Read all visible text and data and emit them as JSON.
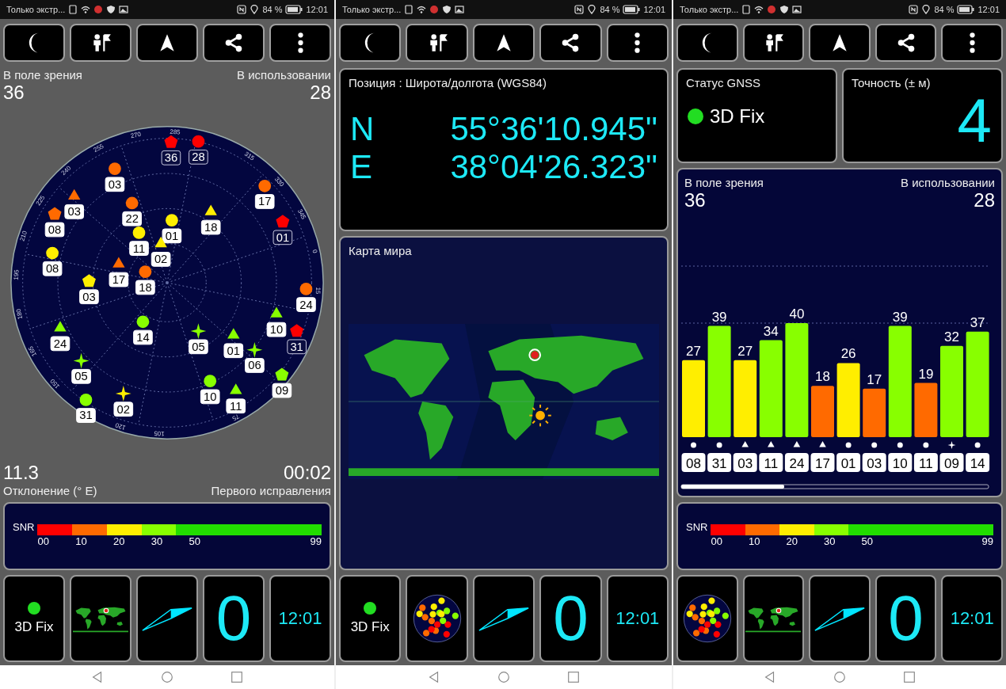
{
  "screens": [
    {
      "kind": "skyplot",
      "status_bar": {
        "notification": "Только экстр...",
        "battery": "84 %",
        "time": "12:01"
      },
      "in_view": {
        "label": "В поле зрения",
        "value": "36"
      },
      "in_use": {
        "label": "В использовании",
        "value": "28"
      },
      "sky_plot": {
        "azimuth_labels": [
          "0",
          "15",
          "75",
          "105",
          "120",
          "150",
          "165",
          "180",
          "195",
          "210",
          "225",
          "240",
          "255",
          "270",
          "285",
          "315",
          "330",
          "345"
        ],
        "satellites": [
          {
            "label": "36",
            "kind": "pentagon",
            "color": "#ff0000",
            "used": false
          },
          {
            "label": "28",
            "kind": "circle",
            "color": "#ff0000",
            "used": false
          },
          {
            "label": "03",
            "kind": "circle",
            "color": "#ff6a00",
            "used": true
          },
          {
            "label": "03",
            "kind": "triangle",
            "color": "#ff6a00",
            "used": true
          },
          {
            "label": "08",
            "kind": "pentagon",
            "color": "#ff6a00",
            "used": true
          },
          {
            "label": "22",
            "kind": "circle",
            "color": "#ff6a00",
            "used": true
          },
          {
            "label": "01",
            "kind": "circle",
            "color": "#ffee00",
            "used": true
          },
          {
            "label": "18",
            "kind": "triangle",
            "color": "#ffee00",
            "used": true
          },
          {
            "label": "17",
            "kind": "circle",
            "color": "#ff6a00",
            "used": true
          },
          {
            "label": "01",
            "kind": "pentagon",
            "color": "#ff0000",
            "used": false
          },
          {
            "label": "08",
            "kind": "circle",
            "color": "#ffee00",
            "used": true
          },
          {
            "label": "11",
            "kind": "circle",
            "color": "#ffee00",
            "used": true
          },
          {
            "label": "02",
            "kind": "triangle",
            "color": "#ffee00",
            "used": true
          },
          {
            "label": "17",
            "kind": "triangle",
            "color": "#ff6a00",
            "used": true
          },
          {
            "label": "18",
            "kind": "circle",
            "color": "#ff6a00",
            "used": true
          },
          {
            "label": "03",
            "kind": "pentagon",
            "color": "#ffee00",
            "used": true
          },
          {
            "label": "24",
            "kind": "circle",
            "color": "#ff6a00",
            "used": true
          },
          {
            "label": "10",
            "kind": "triangle",
            "color": "#88ff00",
            "used": true
          },
          {
            "label": "31",
            "kind": "pentagon",
            "color": "#ff0000",
            "used": false
          },
          {
            "label": "24",
            "kind": "triangle",
            "color": "#88ff00",
            "used": true
          },
          {
            "label": "14",
            "kind": "circle",
            "color": "#88ff00",
            "used": true
          },
          {
            "label": "05",
            "kind": "star",
            "color": "#88ff00",
            "used": true
          },
          {
            "label": "01",
            "kind": "triangle",
            "color": "#88ff00",
            "used": true
          },
          {
            "label": "06",
            "kind": "star",
            "color": "#88ff00",
            "used": true
          },
          {
            "label": "05",
            "kind": "star",
            "color": "#88ff00",
            "used": true
          },
          {
            "label": "09",
            "kind": "pentagon",
            "color": "#88ff00",
            "used": true
          },
          {
            "label": "10",
            "kind": "circle",
            "color": "#88ff00",
            "used": true
          },
          {
            "label": "31",
            "kind": "circle",
            "color": "#88ff00",
            "used": true
          },
          {
            "label": "02",
            "kind": "star",
            "color": "#ffee00",
            "used": true
          },
          {
            "label": "11",
            "kind": "triangle",
            "color": "#88ff00",
            "used": true
          }
        ]
      },
      "declination": {
        "label": "Отклонение (° E)",
        "value": "11.3"
      },
      "first_fix": {
        "label": "Первого исправления",
        "value": "00:02"
      },
      "snr_legend": {
        "title": "SNR",
        "end_label": "99",
        "segments": [
          {
            "label": "00",
            "color": "#ff0000"
          },
          {
            "label": "10",
            "color": "#ff6a00"
          },
          {
            "label": "20",
            "color": "#ffee00"
          },
          {
            "label": "30",
            "color": "#88ff00"
          },
          {
            "label": "50",
            "color": "#22dd00"
          }
        ]
      },
      "tiles": [
        {
          "kind": "fix",
          "text": "3D Fix"
        },
        {
          "kind": "map"
        },
        {
          "kind": "arrow"
        },
        {
          "kind": "number",
          "text": "0"
        },
        {
          "kind": "time",
          "text": "12:01"
        }
      ]
    },
    {
      "kind": "position",
      "status_bar": {
        "notification": "Только экстр...",
        "battery": "84 %",
        "time": "12:01"
      },
      "position": {
        "title": "Позиция : Широта/долгота (WGS84)",
        "rows": [
          {
            "hemisphere": "N",
            "value": "55°36'10.945\""
          },
          {
            "hemisphere": "E",
            "value": "38°04'26.323\""
          }
        ]
      },
      "world_map": {
        "title": "Карта мира"
      },
      "tiles": [
        {
          "kind": "fix",
          "text": "3D Fix"
        },
        {
          "kind": "sky"
        },
        {
          "kind": "arrow"
        },
        {
          "kind": "number",
          "text": "0"
        },
        {
          "kind": "time",
          "text": "12:01"
        }
      ]
    },
    {
      "kind": "signal",
      "status_bar": {
        "notification": "Только экстр...",
        "battery": "84 %",
        "time": "12:01"
      },
      "gnss_status": {
        "title": "Статус GNSS",
        "value": "3D Fix"
      },
      "accuracy": {
        "title": "Точность (± м)",
        "value": "4"
      },
      "signal_chart": {
        "in_view": {
          "label": "В поле зрения",
          "value": "36"
        },
        "in_use": {
          "label": "В использовании",
          "value": "28"
        },
        "bar_markers": [
          {
            "kind": "circle"
          },
          {
            "kind": "circle"
          },
          {
            "kind": "triangle"
          },
          {
            "kind": "triangle"
          },
          {
            "kind": "triangle"
          },
          {
            "kind": "triangle"
          },
          {
            "kind": "circle"
          },
          {
            "kind": "circle"
          },
          {
            "kind": "circle"
          },
          {
            "kind": "circle"
          },
          {
            "kind": "star"
          },
          {
            "kind": "circle"
          }
        ],
        "chart_data": {
          "type": "bar",
          "categories": [
            "08",
            "31",
            "03",
            "11",
            "24",
            "17",
            "01",
            "03",
            "10",
            "11",
            "09",
            "14"
          ],
          "values": [
            27,
            39,
            27,
            34,
            40,
            18,
            26,
            17,
            39,
            19,
            32,
            37
          ],
          "data_labels": true
        }
      },
      "snr_legend": {
        "title": "SNR",
        "end_label": "99",
        "segments": [
          {
            "label": "00",
            "color": "#ff0000"
          },
          {
            "label": "10",
            "color": "#ff6a00"
          },
          {
            "label": "20",
            "color": "#ffee00"
          },
          {
            "label": "30",
            "color": "#88ff00"
          },
          {
            "label": "50",
            "color": "#22dd00"
          }
        ]
      },
      "tiles": [
        {
          "kind": "sky"
        },
        {
          "kind": "map"
        },
        {
          "kind": "arrow"
        },
        {
          "kind": "number",
          "text": "0"
        },
        {
          "kind": "time",
          "text": "12:01"
        }
      ]
    }
  ]
}
